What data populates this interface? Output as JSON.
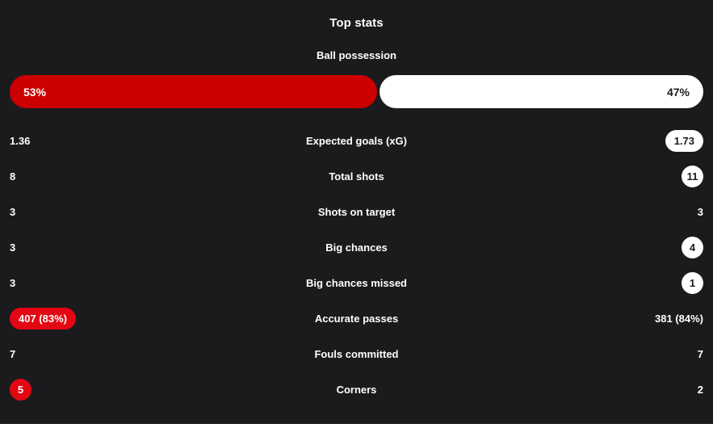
{
  "panel": {
    "title": "Top stats"
  },
  "possession": {
    "label": "Ball possession",
    "home_text": "53%",
    "away_text": "47%",
    "home_percent": 53,
    "away_percent": 47,
    "home_color": "#cc0000",
    "away_color": "#ffffff"
  },
  "colors": {
    "background": "#1b1b1d",
    "highlight_home": "#e30613",
    "highlight_away": "#ffffff",
    "text": "#ffffff"
  },
  "stats": [
    {
      "name": "Expected goals (xG)",
      "home": {
        "value": "1.36",
        "style": "plain"
      },
      "away": {
        "value": "1.73",
        "style": "pill-away"
      }
    },
    {
      "name": "Total shots",
      "home": {
        "value": "8",
        "style": "plain"
      },
      "away": {
        "value": "11",
        "style": "pill-away-circle"
      }
    },
    {
      "name": "Shots on target",
      "home": {
        "value": "3",
        "style": "plain"
      },
      "away": {
        "value": "3",
        "style": "plain"
      }
    },
    {
      "name": "Big chances",
      "home": {
        "value": "3",
        "style": "plain"
      },
      "away": {
        "value": "4",
        "style": "pill-away-circle"
      }
    },
    {
      "name": "Big chances missed",
      "home": {
        "value": "3",
        "style": "plain"
      },
      "away": {
        "value": "1",
        "style": "pill-away-circle"
      }
    },
    {
      "name": "Accurate passes",
      "home": {
        "value": "407 (83%)",
        "style": "pill-home"
      },
      "away": {
        "value": "381 (84%)",
        "style": "plain"
      }
    },
    {
      "name": "Fouls committed",
      "home": {
        "value": "7",
        "style": "plain"
      },
      "away": {
        "value": "7",
        "style": "plain"
      }
    },
    {
      "name": "Corners",
      "home": {
        "value": "5",
        "style": "pill-home-circle"
      },
      "away": {
        "value": "2",
        "style": "plain"
      }
    }
  ]
}
